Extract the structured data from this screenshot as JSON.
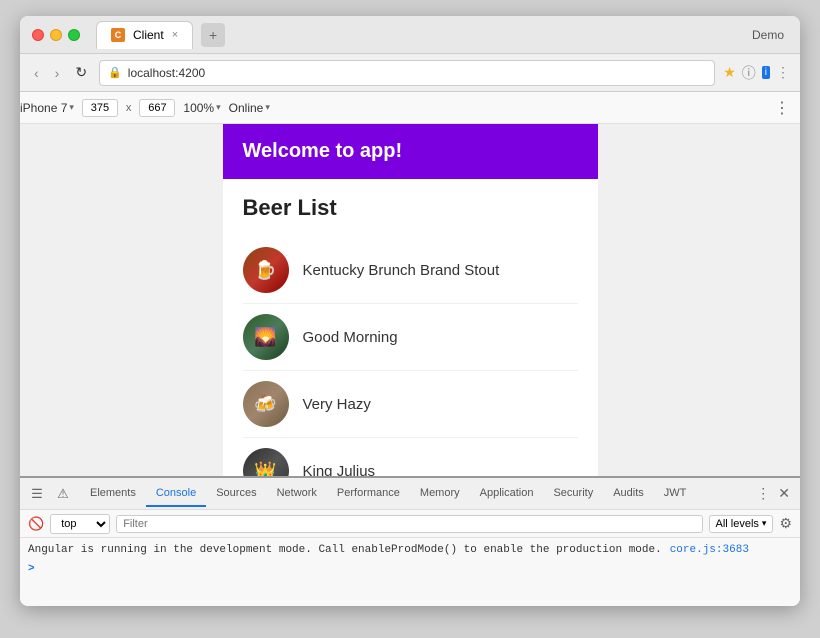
{
  "browser": {
    "tab": {
      "favicon": "C",
      "title": "Client",
      "close": "×"
    },
    "demo_label": "Demo",
    "address": {
      "back": "‹",
      "forward": "›",
      "refresh": "↻",
      "lock_icon": "🔒",
      "url": "localhost:4200"
    },
    "device_toolbar": {
      "device": "iPhone 7",
      "chevron": "▾",
      "width": "375",
      "x": "x",
      "height": "667",
      "zoom": "100%",
      "zoom_chevron": "▾",
      "online": "Online",
      "online_chevron": "▾",
      "more_icon": "⋮"
    }
  },
  "app": {
    "header": "Welcome to app!",
    "beer_list_title": "Beer List",
    "beers": [
      {
        "name": "Kentucky Brunch Brand Stout",
        "emoji": "🍺"
      },
      {
        "name": "Good Morning",
        "emoji": "🌄"
      },
      {
        "name": "Very Hazy",
        "emoji": "🍻"
      },
      {
        "name": "King Julius",
        "emoji": "👑"
      }
    ]
  },
  "devtools": {
    "tabs": [
      {
        "label": "Elements",
        "active": false
      },
      {
        "label": "Console",
        "active": true
      },
      {
        "label": "Sources",
        "active": false
      },
      {
        "label": "Network",
        "active": false
      },
      {
        "label": "Performance",
        "active": false
      },
      {
        "label": "Memory",
        "active": false
      },
      {
        "label": "Application",
        "active": false
      },
      {
        "label": "Security",
        "active": false
      },
      {
        "label": "Audits",
        "active": false
      },
      {
        "label": "JWT",
        "active": false
      }
    ],
    "toolbar": {
      "context": "top",
      "filter_placeholder": "Filter",
      "levels": "All levels"
    },
    "console": {
      "message": "Angular is running in the development mode. Call enableProdMode() to enable the production mode.",
      "link": "core.js:3683",
      "prompt": ">"
    }
  }
}
